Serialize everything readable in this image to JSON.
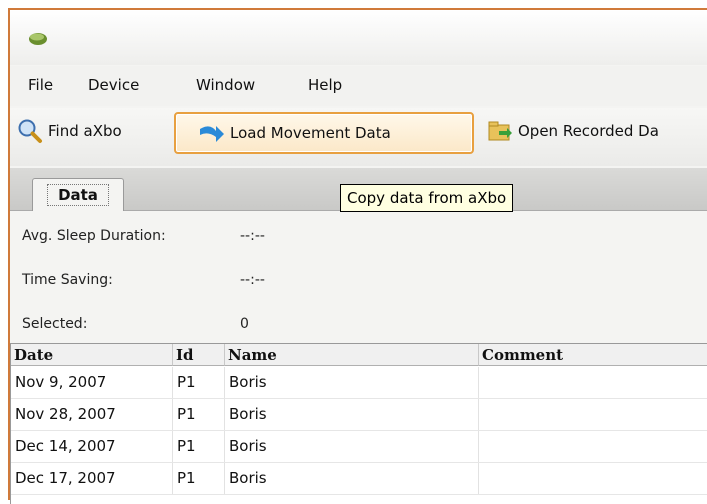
{
  "menu": [
    "File",
    "Device",
    "Window",
    "Help"
  ],
  "toolbar": {
    "find_label": "Find aXbo",
    "load_label": "Load Movement Data",
    "open_label": "Open Recorded Da"
  },
  "tab_label": "Data",
  "tooltip": "Copy data from aXbo",
  "stats": {
    "avg_label": "Avg. Sleep Duration:",
    "avg_value": "--:--",
    "saving_label": "Time Saving:",
    "saving_value": "--:--",
    "selected_label": "Selected:",
    "selected_value": "0"
  },
  "table": {
    "headers": [
      "Date",
      "Id",
      "Name",
      "Comment"
    ],
    "rows": [
      {
        "date": "Nov 9, 2007",
        "id": "P1",
        "name": "Boris",
        "comment": ""
      },
      {
        "date": "Nov 28, 2007",
        "id": "P1",
        "name": "Boris",
        "comment": ""
      },
      {
        "date": "Dec 14, 2007",
        "id": "P1",
        "name": "Boris",
        "comment": ""
      },
      {
        "date": "Dec 17, 2007",
        "id": "P1",
        "name": "Boris",
        "comment": ""
      }
    ]
  },
  "colors": {
    "accent_border": "#d07a3a",
    "highlight": "#e8a040",
    "tooltip_bg": "#ffffe1"
  }
}
